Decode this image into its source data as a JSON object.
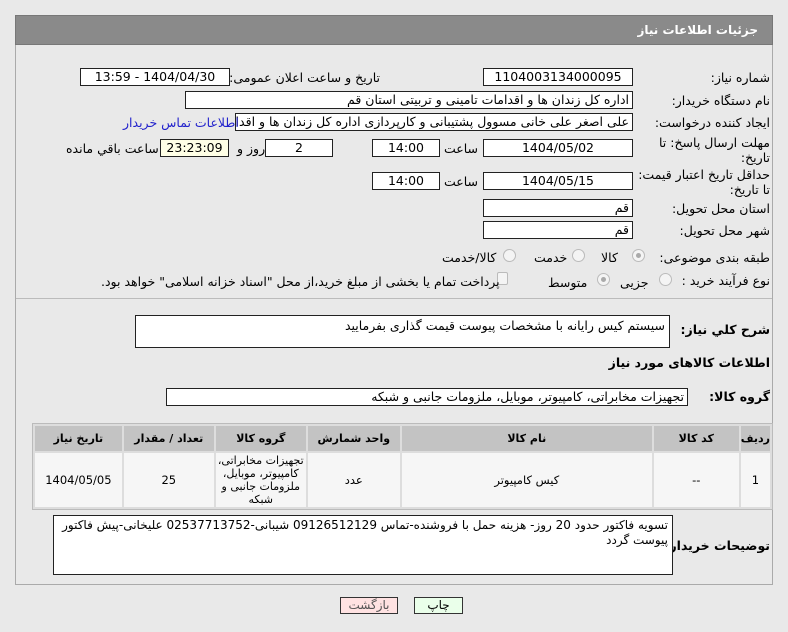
{
  "header": {
    "title": "جزئیات اطلاعات نیاز"
  },
  "form": {
    "need_number_label": "شماره نیاز:",
    "need_number": "1104003134000095",
    "announce_label": "تاریخ و ساعت اعلان عمومی:",
    "announce_value": "1404/04/30 - 13:59",
    "buyer_org_label": "نام دستگاه خریدار:",
    "buyer_org": "اداره کل زندان ها و اقدامات تامینی و تربیتی استان قم",
    "creator_label": "ایجاد کننده درخواست:",
    "creator": "علی اصغر علی خانی مسوول پشتیبانی و کارپردازی اداره کل زندان ها و اقدامات",
    "contact_link": "اطلاعات تماس خریدار",
    "deadline_label": "مهلت ارسال پاسخ: تا تاریخ:",
    "deadline_date": "1404/05/02",
    "time_label": "ساعت",
    "deadline_time": "14:00",
    "days": "2",
    "days_label": "روز و",
    "remaining": "23:23:09",
    "remaining_label": "ساعت باقي مانده",
    "validity_label": "حداقل تاریخ اعتبار قیمت: تا تاریخ:",
    "validity_date": "1404/05/15",
    "validity_time": "14:00",
    "province_label": "استان محل تحویل:",
    "province": "قم",
    "city_label": "شهر محل تحویل:",
    "city": "قم",
    "category_label": "طبقه بندی موضوعی:",
    "category_options": [
      "کالا",
      "خدمت",
      "کالا/خدمت"
    ],
    "process_label": "نوع فرآیند خرید :",
    "process_options": [
      "جزیی",
      "متوسط"
    ],
    "treasury_note": "پرداخت تمام یا بخشی از مبلغ خرید،از محل \"اسناد خزانه اسلامی\" خواهد بود.",
    "description_label": "شرح کلي نياز:",
    "description": "سیستم کیس رایانه با مشخصات پیوست قیمت گذاری بفرمایید"
  },
  "goods": {
    "heading": "اطلاعات کالاهای مورد نیاز",
    "group_label": "گروه کالا:",
    "group": "تجهیزات مخابراتی، کامپیوتر، موبایل، ملزومات جانبی و شبکه",
    "columns": [
      "ردیف",
      "کد کالا",
      "نام کالا",
      "واحد شمارش",
      "گروه کالا",
      "تعداد / مقدار",
      "تاریخ نیاز"
    ],
    "rows": [
      [
        "1",
        "--",
        "کیس کامپیوتر",
        "عدد",
        "تجهیزات مخابراتی، کامپیوتر، موبایل، ملزومات جانبی و شبکه",
        "25",
        "1404/05/05"
      ]
    ]
  },
  "notes": {
    "label": "توضیحات خریدار:",
    "text": "تسویه فاکتور حدود 20 روز- هزینه حمل با فروشنده-تماس 09126512129 شیبانی-02537713752 علیخانی-پیش فاکتور پیوست گردد"
  },
  "buttons": {
    "print": "چاپ",
    "back": "بازگشت"
  }
}
